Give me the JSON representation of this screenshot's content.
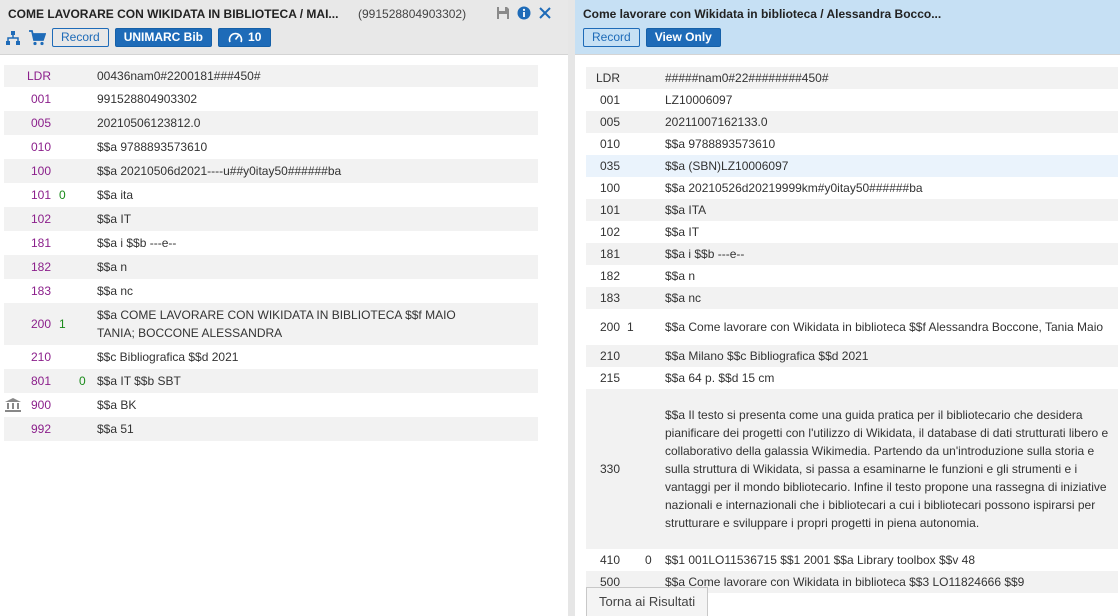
{
  "left": {
    "title": "COME LAVORARE CON WIKIDATA IN BIBLIOTECA / MAI...",
    "mms_id": "(991528804903302)",
    "record_button": "Record",
    "format_badge": "UNIMARC Bib",
    "gauge_value": "10",
    "fields": [
      {
        "tag": "LDR",
        "ind1": "",
        "ind2": "",
        "content": "00436nam0#2200181###450#"
      },
      {
        "tag": "001",
        "ind1": "",
        "ind2": "",
        "content": "991528804903302"
      },
      {
        "tag": "005",
        "ind1": "",
        "ind2": "",
        "content": "20210506123812.0"
      },
      {
        "tag": "010",
        "ind1": "",
        "ind2": "",
        "content": "$$a 9788893573610"
      },
      {
        "tag": "100",
        "ind1": "",
        "ind2": "",
        "content": "$$a 20210506d2021----u##y0itay50######ba"
      },
      {
        "tag": "101",
        "ind1": "0",
        "ind2": "",
        "content": "$$a ita"
      },
      {
        "tag": "102",
        "ind1": "",
        "ind2": "",
        "content": "$$a IT"
      },
      {
        "tag": "181",
        "ind1": "",
        "ind2": "",
        "content": "$$a i $$b ---e--"
      },
      {
        "tag": "182",
        "ind1": "",
        "ind2": "",
        "content": "$$a n"
      },
      {
        "tag": "183",
        "ind1": "",
        "ind2": "",
        "content": "$$a nc"
      },
      {
        "tag": "200",
        "ind1": "1",
        "ind2": "",
        "content": "$$a COME LAVORARE CON WIKIDATA IN BIBLIOTECA $$f MAIO TANIA; BOCCONE ALESSANDRA"
      },
      {
        "tag": "210",
        "ind1": "",
        "ind2": "",
        "content": "$$c Bibliografica $$d 2021"
      },
      {
        "tag": "801",
        "ind1": "",
        "ind2": "0",
        "content": "$$a IT $$b SBT"
      },
      {
        "tag": "900",
        "ind1": "",
        "ind2": "",
        "content": "$$a BK",
        "icon": "library-icon"
      },
      {
        "tag": "992",
        "ind1": "",
        "ind2": "",
        "content": "$$a 51"
      }
    ]
  },
  "right": {
    "title": "Come lavorare con Wikidata in biblioteca / Alessandra Bocco...",
    "record_button": "Record",
    "view_only_badge": "View Only",
    "back_button": "Torna ai Risultati",
    "fields": [
      {
        "tag": "LDR",
        "ind1": "",
        "ind2": "",
        "content": "#####nam0#22########450#"
      },
      {
        "tag": "001",
        "ind1": "",
        "ind2": "",
        "content": "LZ10006097"
      },
      {
        "tag": "005",
        "ind1": "",
        "ind2": "",
        "content": "20211007162133.0"
      },
      {
        "tag": "010",
        "ind1": "",
        "ind2": "",
        "content": "$$a 9788893573610"
      },
      {
        "tag": "035",
        "ind1": "",
        "ind2": "",
        "content": "$$a (SBN)LZ10006097"
      },
      {
        "tag": "100",
        "ind1": "",
        "ind2": "",
        "content": "$$a 20210526d20219999km#y0itay50######ba"
      },
      {
        "tag": "101",
        "ind1": "",
        "ind2": "",
        "content": "$$a ITA"
      },
      {
        "tag": "102",
        "ind1": "",
        "ind2": "",
        "content": "$$a IT"
      },
      {
        "tag": "181",
        "ind1": "",
        "ind2": "",
        "content": "$$a i $$b ---e--"
      },
      {
        "tag": "182",
        "ind1": "",
        "ind2": "",
        "content": "$$a n"
      },
      {
        "tag": "183",
        "ind1": "",
        "ind2": "",
        "content": "$$a nc"
      },
      {
        "tag": "200",
        "ind1": "1",
        "ind2": "",
        "content": "$$a Come lavorare con Wikidata in biblioteca $$f Alessandra Boccone, Tania Maio"
      },
      {
        "tag": "210",
        "ind1": "",
        "ind2": "",
        "content": "$$a Milano $$c Bibliografica $$d 2021"
      },
      {
        "tag": "215",
        "ind1": "",
        "ind2": "",
        "content": "$$a 64 p. $$d 15 cm"
      },
      {
        "tag": "330",
        "ind1": "",
        "ind2": "",
        "content": "$$a Il testo si presenta come una guida pratica per il bibliotecario che desidera pianificare dei progetti con l'utilizzo di Wikidata, il database di dati strutturati libero e collaborativo della galassia Wikimedia. Partendo da un'introduzione sulla storia e sulla struttura di Wikidata, si passa a esaminarne le funzioni e gli strumenti e i vantaggi per il mondo bibliotecario. Infine il testo propone una rassegna di iniziative nazionali e internazionali che i bibliotecari a cui i bibliotecari possono ispirarsi per strutturare e sviluppare i propri progetti in piena autonomia."
      },
      {
        "tag": "410",
        "ind1": "",
        "ind2": "0",
        "content": "$$1 001LO11536715 $$1 2001 $$a Library toolbox $$v 48"
      },
      {
        "tag": "500",
        "ind1": "",
        "ind2": "",
        "content": "$$a Come lavorare con Wikidata in biblioteca $$3 LO11824666 $$9"
      }
    ]
  },
  "colors": {
    "accent": "#1e6bb8",
    "left_header_bg": "#e8e8e8",
    "right_header_bg": "#c6e0f4",
    "tag_purple": "#8b1f8b",
    "indicator_green": "#1a8a1a"
  },
  "icons": [
    "save-icon",
    "info-icon",
    "close-icon",
    "hierarchy-icon",
    "cart-icon",
    "gauge-icon",
    "library-icon"
  ]
}
